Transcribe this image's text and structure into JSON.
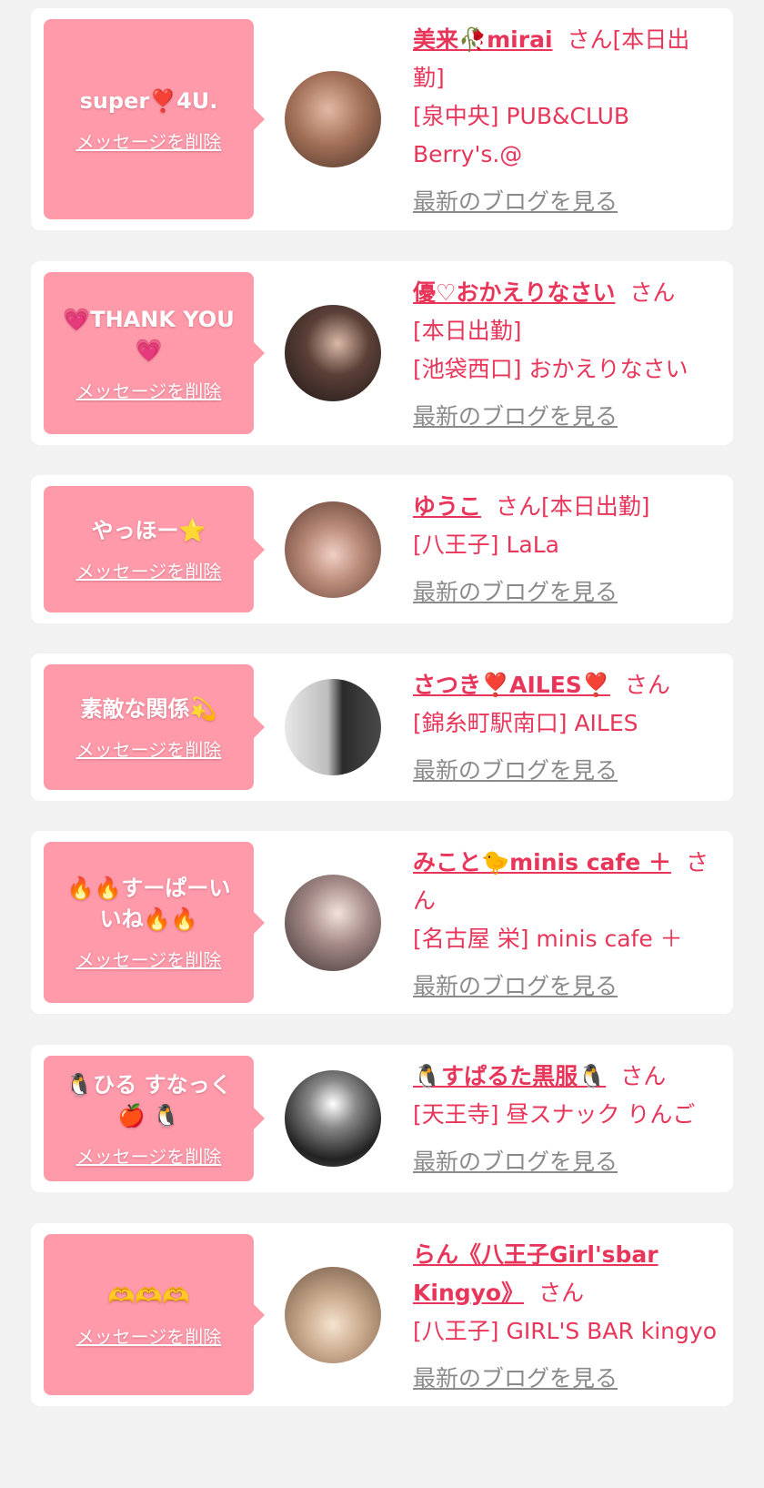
{
  "delete_label": "メッセージを削除",
  "blog_label": "最新のブログを見る",
  "san_label": "さん",
  "cards": [
    {
      "message": "super❣️4U.",
      "name": "美来🥀mirai",
      "status": "[本日出勤]",
      "shop": "[泉中央] PUB&CLUB Berry's.@"
    },
    {
      "message": "💗THANK YOU💗",
      "name": "優♡おかえりなさい",
      "status": "[本日出勤]",
      "shop": "[池袋西口] おかえりなさい"
    },
    {
      "message": "やっほー⭐",
      "name": "ゆうこ",
      "status": "[本日出勤]",
      "shop": "[八王子] LaLa"
    },
    {
      "message": "素敵な関係💫",
      "name": "さつき❣️AILES❣️",
      "status": "",
      "shop": "[錦糸町駅南口] AILES"
    },
    {
      "message": "🔥🔥すーぱーいいね🔥🔥",
      "name": "みこと🐤minis cafe ＋",
      "status": "",
      "shop": "[名古屋 栄] minis cafe ＋"
    },
    {
      "message": "🐧ひる すなっく🍎 🐧",
      "name": "🐧すぱるた黒服🐧",
      "status": "",
      "shop": "[天王寺] 昼スナック りんご"
    },
    {
      "message": "🫶🫶🫶",
      "name": "らん《八王子Girl'sbar Kingyo》",
      "status": "",
      "shop": "[八王子] GIRL'S BAR kingyo"
    }
  ]
}
